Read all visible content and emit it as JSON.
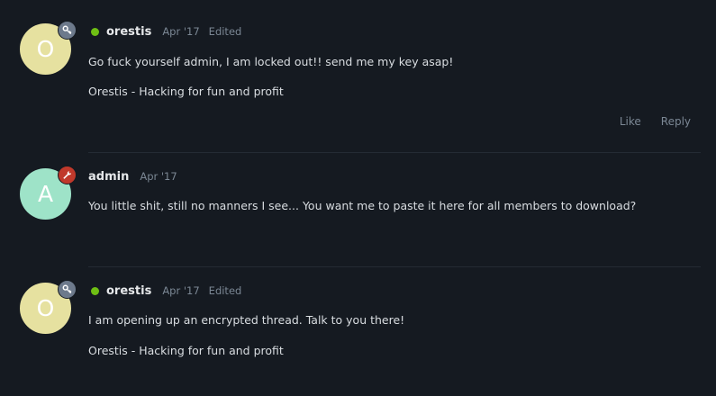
{
  "posts": [
    {
      "avatar_letter": "O",
      "avatar_color": "#e6e1a0",
      "badge": "key-icon",
      "badge_color": "#6d7a8c",
      "online": true,
      "username": "orestis",
      "date": "Apr '17",
      "edited": "Edited",
      "lines": [
        "Go fuck yourself admin, I am locked out!! send me my key asap!",
        "Orestis - Hacking for fun and profit"
      ],
      "actions": {
        "like": "Like",
        "reply": "Reply"
      }
    },
    {
      "avatar_letter": "A",
      "avatar_color": "#9ee3c8",
      "badge": "wrench-icon",
      "badge_color": "#c0392b",
      "online": false,
      "username": "admin",
      "date": "Apr '17",
      "lines": [
        "You little shit, still no manners I see... You want me to paste it here for all members to download?"
      ]
    },
    {
      "avatar_letter": "O",
      "avatar_color": "#e6e1a0",
      "badge": "key-icon",
      "badge_color": "#6d7a8c",
      "online": true,
      "username": "orestis",
      "date": "Apr '17",
      "edited": "Edited",
      "lines": [
        "I am opening up an encrypted thread. Talk to you there!",
        "Orestis - Hacking for fun and profit"
      ]
    }
  ]
}
